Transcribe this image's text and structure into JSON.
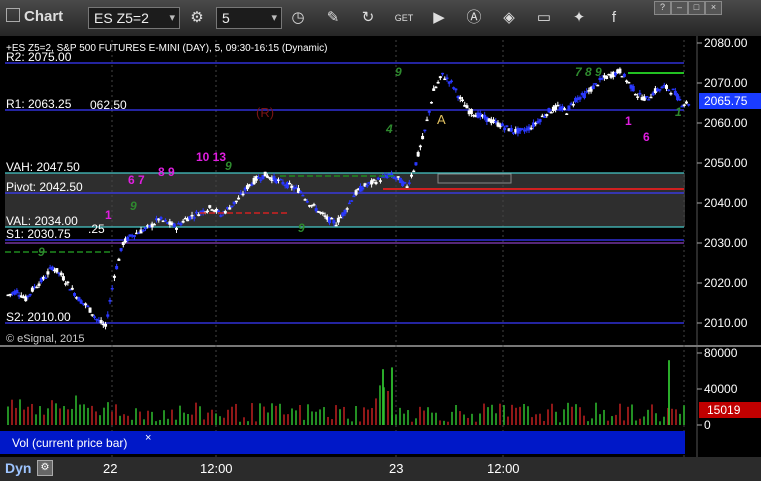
{
  "toolbar": {
    "title": "Chart",
    "symbol": "ES Z5=2",
    "interval": "5",
    "icons": [
      "link-icon",
      "interval-clock-icon",
      "draw-pen-icon",
      "refresh-icon",
      "get-icon",
      "play-icon",
      "alert-icon",
      "tag-icon",
      "chat-icon",
      "twitter-icon",
      "facebook-icon"
    ]
  },
  "header": {
    "description": "+ES Z5=2, S&P 500 FUTURES E-MINI (DAY), 5, 09:30-16:15 (Dynamic)",
    "copyright": "© eSignal, 2015"
  },
  "levels": [
    {
      "label": "R2: 2075.00",
      "price": 2075.0,
      "color": "#3b3bff"
    },
    {
      "label": "R1: 2063.25",
      "price": 2063.25,
      "color": "#3b3bff"
    },
    {
      "label": "VAH: 2047.50",
      "price": 2047.5,
      "color": "#46c8c8"
    },
    {
      "label": "Pivot: 2042.50",
      "price": 2042.5,
      "color": "#3b3bff"
    },
    {
      "label": "VAL: 2034.00",
      "price": 2034.0,
      "color": "#46c8c8"
    },
    {
      "label": "S1: 2030.75",
      "price": 2030.75,
      "color": "#3b3bff"
    },
    {
      "label": "S2: 2010.00",
      "price": 2010.0,
      "color": "#3b3bff"
    }
  ],
  "annotations": {
    "r_marker": "(R)",
    "a_marker": "A",
    "r1_partial": "062.50",
    "s1_partial": ".25"
  },
  "price_axis": {
    "ticks": [
      "2080.00",
      "2070.00",
      "2060.00",
      "2050.00",
      "2040.00",
      "2030.00",
      "2020.00",
      "2010.00"
    ],
    "current_price": "2065.75",
    "current_color": "#1a3cff"
  },
  "volume_axis": {
    "ticks": [
      "80000",
      "40000",
      "0"
    ],
    "current_volume": "15019",
    "current_color": "#c00000"
  },
  "volume_panel": {
    "label": "Vol (current price bar)"
  },
  "time_axis": {
    "mode": "Dyn",
    "labels": [
      "22",
      "12:00",
      "23",
      "12:00"
    ]
  },
  "chart_data": {
    "type": "candlestick",
    "symbol": "ES Z5=2",
    "ylim": [
      2005,
      2084
    ],
    "price_points": [
      2017,
      2018,
      2016,
      2019,
      2021,
      2024,
      2022,
      2019,
      2016,
      2014,
      2011,
      2009,
      2022,
      2030,
      2032,
      2033,
      2034,
      2036,
      2035,
      2034,
      2036,
      2037,
      2038,
      2039,
      2037,
      2039,
      2041,
      2044,
      2046,
      2047,
      2046,
      2045,
      2044,
      2043,
      2040,
      2038,
      2036,
      2035,
      2038,
      2042,
      2044,
      2045,
      2046,
      2047,
      2046,
      2044,
      2050,
      2058,
      2068,
      2072,
      2070,
      2066,
      2063,
      2062,
      2061,
      2060,
      2059,
      2058,
      2058,
      2059,
      2061,
      2063,
      2064,
      2063,
      2066,
      2067,
      2069,
      2071,
      2072,
      2073,
      2070,
      2067,
      2066,
      2068,
      2069,
      2068,
      2065
    ],
    "volume_peaks": [
      {
        "x": 383,
        "value": 62000
      },
      {
        "x": 392,
        "value": 64000
      },
      {
        "x": 669,
        "value": 72000
      }
    ]
  }
}
